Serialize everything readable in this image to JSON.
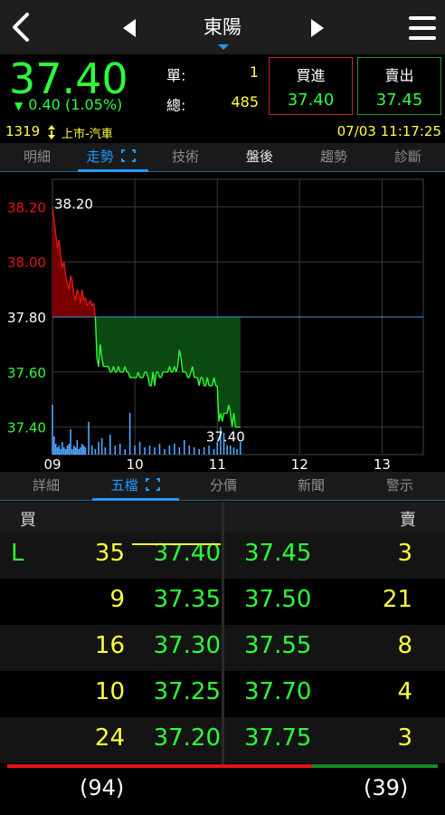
{
  "header": {
    "title": "東陽"
  },
  "quote": {
    "price": "37.40",
    "change": "0.40 (1.05%)",
    "change_direction": "down",
    "single_label": "單:",
    "single_value": "1",
    "total_label": "總:",
    "total_value": "485",
    "buy_label": "買進",
    "buy_price": "37.40",
    "sell_label": "賣出",
    "sell_price": "37.45",
    "code": "1319",
    "market": "上市-汽車",
    "datetime": "07/03 11:17:25"
  },
  "top_tabs": [
    {
      "label": "明細"
    },
    {
      "label": "走勢"
    },
    {
      "label": "技術"
    },
    {
      "label": "盤後"
    },
    {
      "label": "趨勢"
    },
    {
      "label": "診斷"
    }
  ],
  "top_tabs_active": "走勢",
  "bottom_tabs": [
    {
      "label": "詳細"
    },
    {
      "label": "五檔"
    },
    {
      "label": "分價"
    },
    {
      "label": "新聞"
    },
    {
      "label": "警示"
    }
  ],
  "bottom_tabs_active": "五檔",
  "colors": {
    "up": "#e01414",
    "down": "#2bff38",
    "accent": "#1f9cff",
    "volume": "#4ea8ff",
    "text_yellow": "#ffff3a"
  },
  "chart_data": {
    "type": "line",
    "reference_price": 37.8,
    "ylim": [
      37.3,
      38.3
    ],
    "xlim": [
      9,
      13.5
    ],
    "ytick_labels": [
      {
        "value": 38.2,
        "label": "38.20",
        "color": "#e01414"
      },
      {
        "value": 38.0,
        "label": "38.00",
        "color": "#e01414"
      },
      {
        "value": 37.8,
        "label": "37.80",
        "color": "#ffffff"
      },
      {
        "value": 37.6,
        "label": "37.60",
        "color": "#2bff38"
      },
      {
        "value": 37.4,
        "label": "37.40",
        "color": "#2bff38"
      }
    ],
    "xtick_labels": [
      "09",
      "10",
      "11",
      "12",
      "13"
    ],
    "high_annotation": "38.20",
    "low_annotation": "37.40",
    "series": [
      {
        "x": [
          9.0,
          9.02,
          9.04,
          9.06,
          9.08,
          9.1,
          9.12,
          9.14,
          9.16,
          9.18,
          9.2,
          9.22,
          9.24,
          9.26,
          9.28,
          9.3,
          9.32,
          9.34,
          9.36,
          9.38,
          9.4,
          9.42,
          9.44,
          9.46,
          9.48,
          9.5,
          9.52,
          9.54,
          9.56,
          9.58,
          9.6,
          9.62,
          9.64,
          9.66,
          9.68,
          9.7,
          9.72,
          9.74,
          9.76,
          9.78,
          9.8,
          9.82,
          9.84,
          9.86,
          9.88,
          9.9,
          9.92,
          9.94,
          9.96,
          9.98,
          10.0,
          10.02,
          10.04,
          10.06,
          10.08,
          10.1,
          10.12,
          10.14,
          10.16,
          10.18,
          10.2,
          10.22,
          10.24,
          10.26,
          10.28,
          10.3,
          10.32,
          10.34,
          10.36,
          10.38,
          10.4,
          10.42,
          10.44,
          10.46,
          10.48,
          10.5,
          10.52,
          10.54,
          10.56,
          10.58,
          10.6,
          10.62,
          10.64,
          10.66,
          10.68,
          10.7,
          10.72,
          10.74,
          10.76,
          10.78,
          10.8,
          10.82,
          10.84,
          10.86,
          10.88,
          10.9,
          10.92,
          10.94,
          10.96,
          10.98,
          11.0,
          11.02,
          11.04,
          11.06,
          11.08,
          11.1,
          11.12,
          11.14,
          11.16,
          11.18,
          11.2,
          11.22,
          11.24,
          11.26,
          11.28
        ],
        "y": [
          38.2,
          38.15,
          38.1,
          38.05,
          38.08,
          38.02,
          37.98,
          38.0,
          37.95,
          37.92,
          37.9,
          37.95,
          37.93,
          37.88,
          37.86,
          37.9,
          37.88,
          37.85,
          37.9,
          37.86,
          37.87,
          37.84,
          37.85,
          37.86,
          37.84,
          37.85,
          37.8,
          37.65,
          37.62,
          37.7,
          37.65,
          37.62,
          37.62,
          37.62,
          37.62,
          37.6,
          37.6,
          37.62,
          37.6,
          37.6,
          37.62,
          37.6,
          37.6,
          37.6,
          37.62,
          37.6,
          37.6,
          37.58,
          37.58,
          37.58,
          37.58,
          37.58,
          37.6,
          37.58,
          37.58,
          37.58,
          37.6,
          37.6,
          37.58,
          37.55,
          37.55,
          37.6,
          37.55,
          37.6,
          37.6,
          37.58,
          37.58,
          37.6,
          37.6,
          37.6,
          37.6,
          37.62,
          37.6,
          37.6,
          37.62,
          37.6,
          37.62,
          37.68,
          37.65,
          37.6,
          37.6,
          37.6,
          37.58,
          37.58,
          37.6,
          37.62,
          37.58,
          37.58,
          37.58,
          37.55,
          37.58,
          37.58,
          37.55,
          37.55,
          37.58,
          37.55,
          37.55,
          37.55,
          37.58,
          37.55,
          37.55,
          37.42,
          37.45,
          37.42,
          37.45,
          37.45,
          37.45,
          37.48,
          37.45,
          37.4,
          37.45,
          37.4,
          37.4,
          37.4,
          37.4
        ]
      }
    ],
    "volume": {
      "x": [
        9.0,
        9.02,
        9.04,
        9.06,
        9.08,
        9.1,
        9.12,
        9.14,
        9.16,
        9.18,
        9.2,
        9.22,
        9.24,
        9.26,
        9.28,
        9.3,
        9.32,
        9.34,
        9.36,
        9.38,
        9.4,
        9.44,
        9.48,
        9.52,
        9.56,
        9.6,
        9.64,
        9.7,
        9.76,
        9.82,
        9.88,
        9.94,
        10.0,
        10.06,
        10.12,
        10.18,
        10.24,
        10.3,
        10.36,
        10.42,
        10.48,
        10.54,
        10.6,
        10.66,
        10.72,
        10.78,
        10.84,
        10.9,
        10.96,
        11.0,
        11.04,
        11.08,
        11.12,
        11.16,
        11.2,
        11.24,
        11.28
      ],
      "v": [
        55,
        20,
        12,
        8,
        10,
        6,
        14,
        8,
        6,
        10,
        12,
        28,
        6,
        10,
        8,
        16,
        6,
        8,
        12,
        10,
        8,
        36,
        10,
        6,
        14,
        18,
        8,
        22,
        10,
        12,
        6,
        46,
        10,
        14,
        8,
        10,
        8,
        12,
        6,
        10,
        12,
        8,
        16,
        10,
        8,
        6,
        8,
        10,
        6,
        14,
        30,
        24,
        10,
        10,
        8,
        6,
        14
      ]
    }
  }
}
